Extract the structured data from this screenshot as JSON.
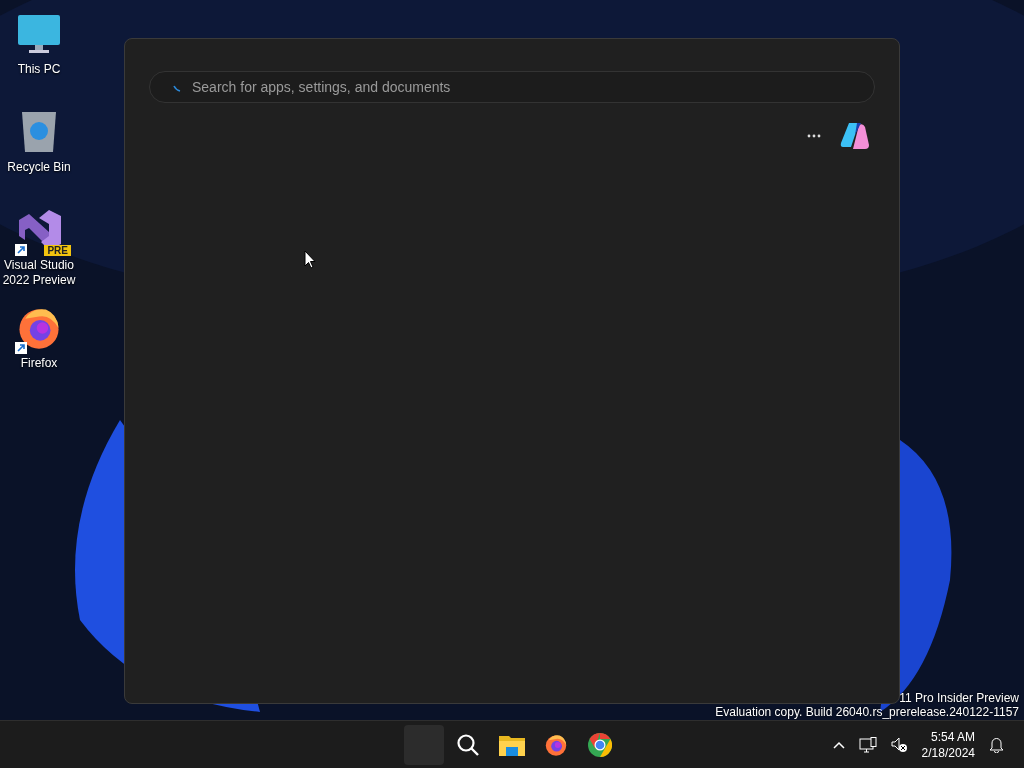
{
  "desktop_icons": [
    {
      "label": "This PC",
      "kind": "pc",
      "shortcut": false
    },
    {
      "label": "Recycle Bin",
      "kind": "bin",
      "shortcut": false
    },
    {
      "label": "Visual Studio 2022 Preview",
      "kind": "vs",
      "shortcut": true,
      "badge": "PRE"
    },
    {
      "label": "Firefox",
      "kind": "firefox",
      "shortcut": true
    }
  ],
  "search_panel": {
    "search": {
      "placeholder": "Search for apps, settings, and documents"
    }
  },
  "watermark": [
    "11 Pro Insider Preview",
    "Evaluation copy. Build 26040.rs_prerelease.240122-1157"
  ],
  "taskbar": {
    "apps": [
      {
        "kind": "start",
        "selected": true
      },
      {
        "kind": "search",
        "selected": false
      },
      {
        "kind": "explorer",
        "selected": false
      },
      {
        "kind": "firefox",
        "selected": false
      },
      {
        "kind": "chrome",
        "selected": false
      }
    ],
    "time": "5:54 AM",
    "date": "2/18/2024"
  }
}
